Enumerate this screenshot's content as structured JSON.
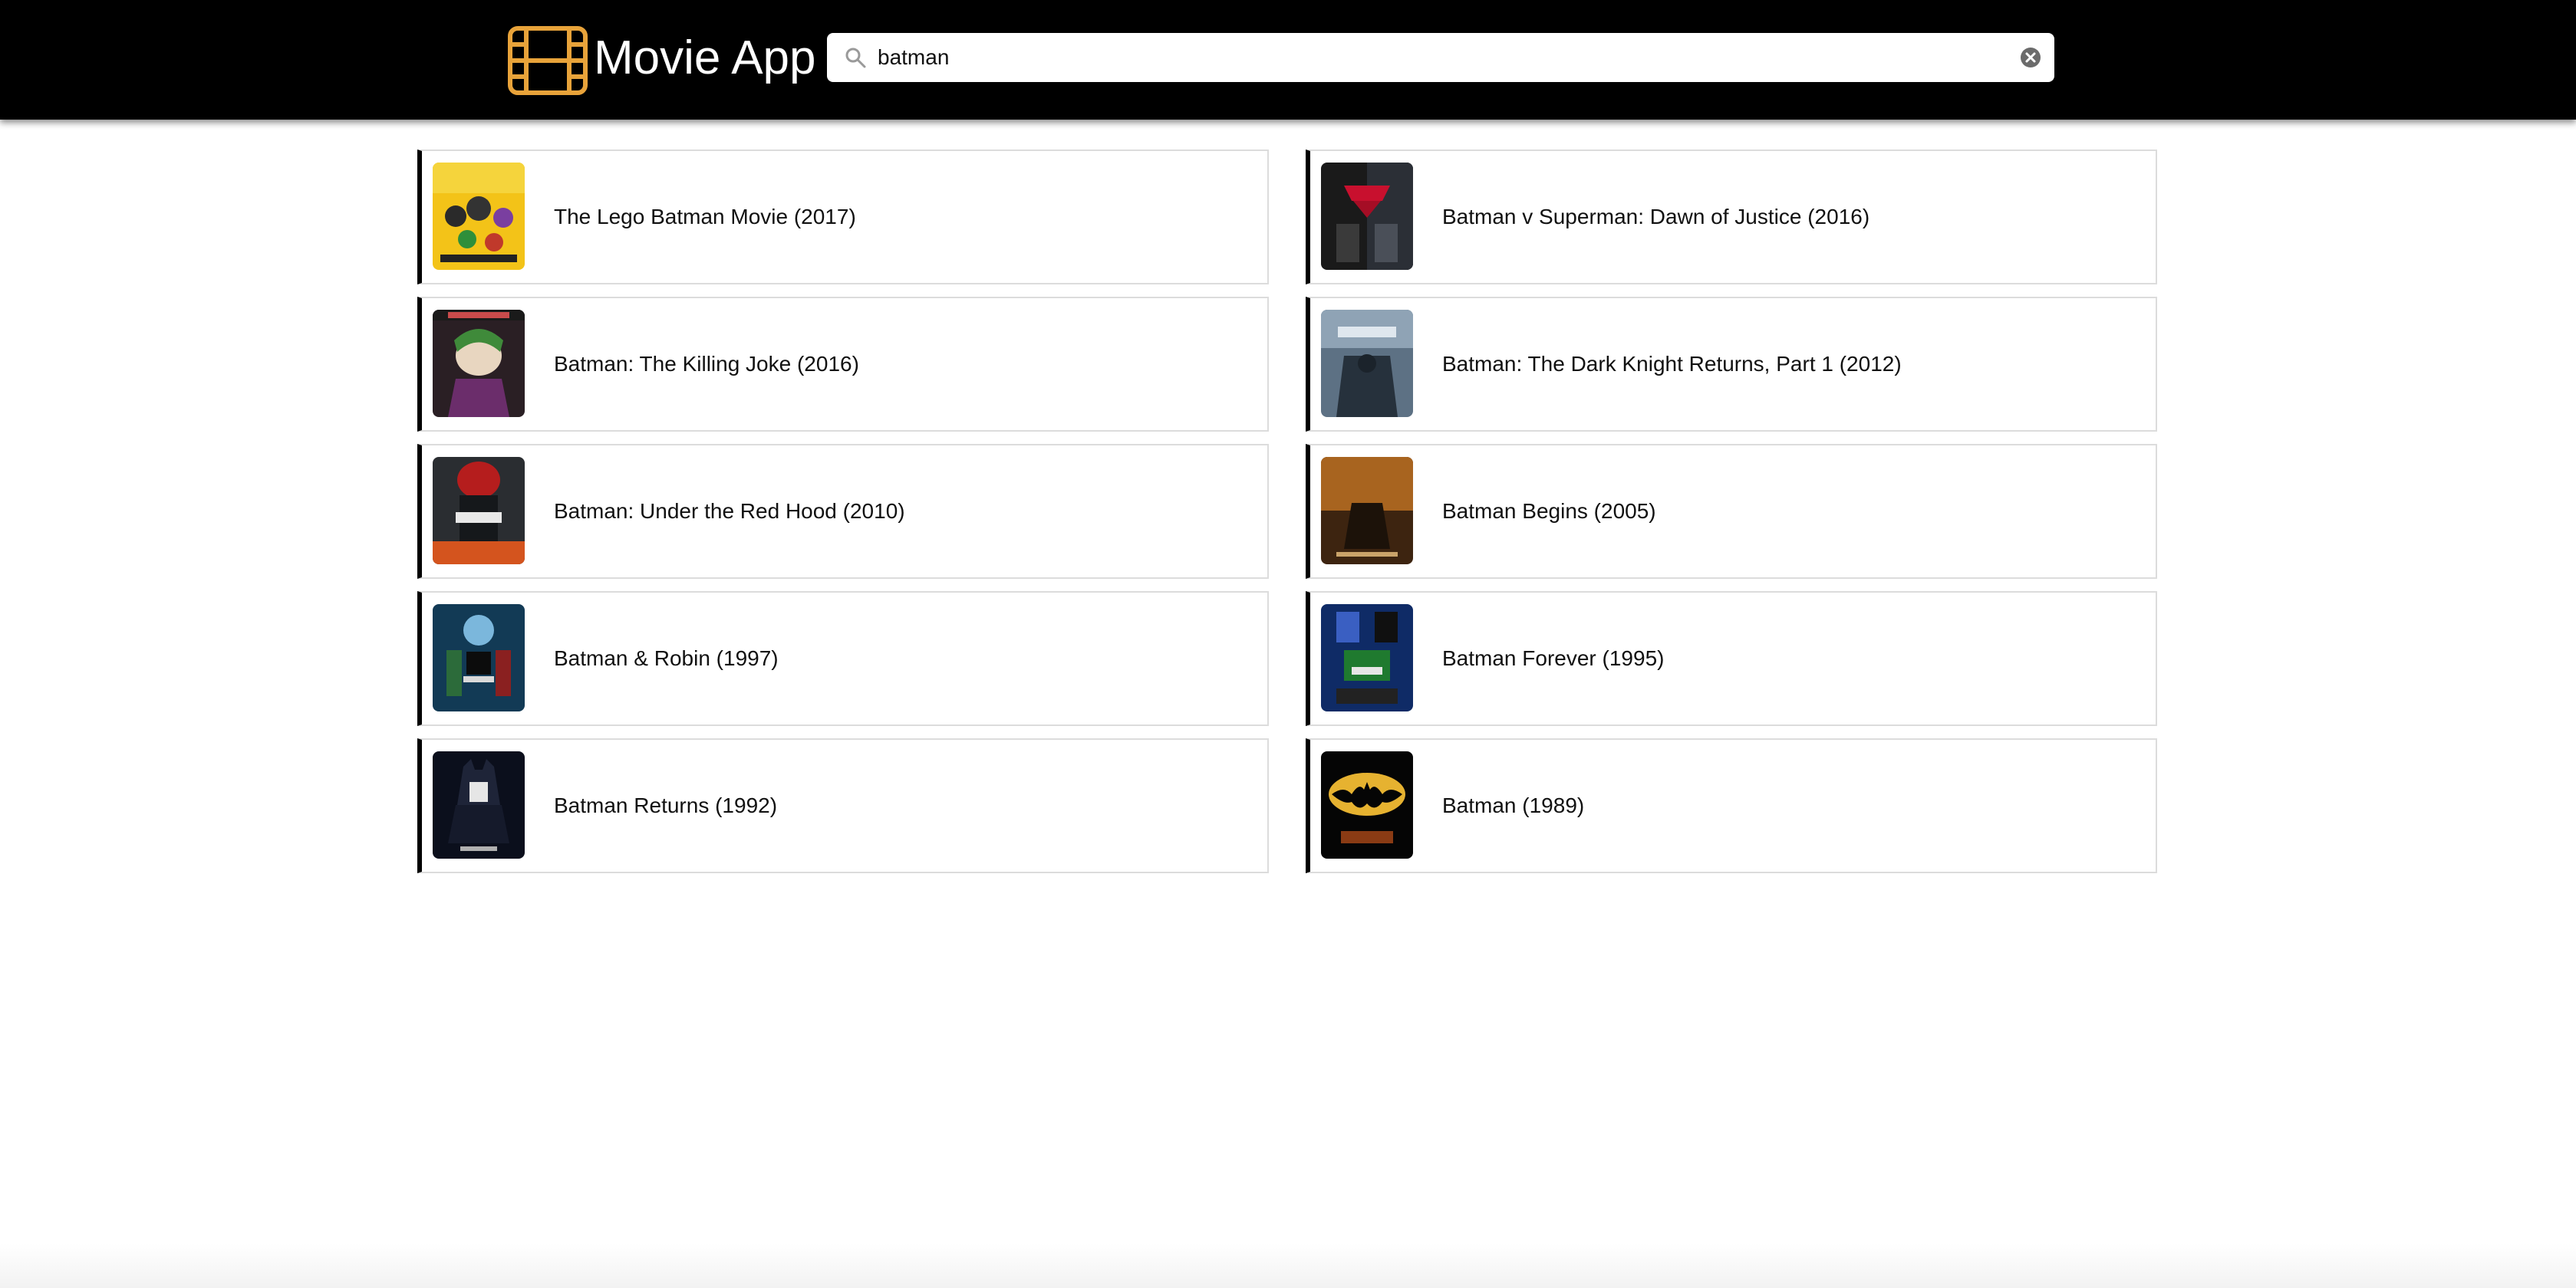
{
  "header": {
    "app_title": "Movie App",
    "logo_icon": "film-strip-icon",
    "accent_color": "#E8A33A"
  },
  "search": {
    "value": "batman",
    "placeholder": "",
    "icon": "search-icon",
    "clear_icon": "clear-circle-icon"
  },
  "results": [
    {
      "title": "The Lego Batman Movie (2017)"
    },
    {
      "title": "Batman v Superman: Dawn of Justice (2016)"
    },
    {
      "title": "Batman: The Killing Joke (2016)"
    },
    {
      "title": "Batman: The Dark Knight Returns, Part 1 (2012)"
    },
    {
      "title": "Batman: Under the Red Hood (2010)"
    },
    {
      "title": "Batman Begins (2005)"
    },
    {
      "title": "Batman & Robin (1997)"
    },
    {
      "title": "Batman Forever (1995)"
    },
    {
      "title": "Batman Returns (1992)"
    },
    {
      "title": "Batman (1989)"
    }
  ]
}
